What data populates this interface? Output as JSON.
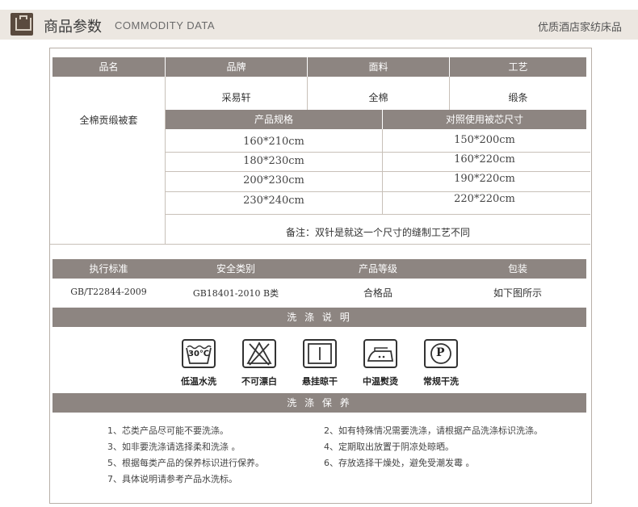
{
  "header": {
    "title_cn": "商品参数",
    "title_en": "COMMODITY DATA",
    "right_text": "优质酒店家纺床品"
  },
  "spec_table": {
    "headers": [
      "品名",
      "品牌",
      "面料",
      "工艺"
    ],
    "product_name": "全棉贡缎被套",
    "brand": "采易轩",
    "fabric": "全棉",
    "craft": "缎条",
    "size_headers": [
      "产品规格",
      "对照使用被芯尺寸"
    ],
    "sizes": [
      [
        "160*210cm",
        "150*200cm"
      ],
      [
        "180*230cm",
        "160*220cm"
      ],
      [
        "200*230cm",
        "190*220cm"
      ],
      [
        "230*240cm",
        "220*220cm"
      ]
    ],
    "remark": "备注：双针是就这一个尺寸的缝制工艺不同"
  },
  "standard_table": {
    "headers": [
      "执行标准",
      "安全类别",
      "产品等级",
      "包装"
    ],
    "values": [
      "GB/T22844-2009",
      "GB18401-2010 B类",
      "合格品",
      "如下图所示"
    ]
  },
  "wash": {
    "section_title": "洗 涤 说 明",
    "icons": [
      {
        "icon": "wash-30-icon",
        "label": "低温水洗",
        "text": "30℃"
      },
      {
        "icon": "no-bleach-icon",
        "label": "不可漂白"
      },
      {
        "icon": "hang-dry-icon",
        "label": "悬挂晾干"
      },
      {
        "icon": "iron-medium-icon",
        "label": "中温熨烫"
      },
      {
        "icon": "dry-clean-p-icon",
        "label": "常规干洗",
        "text": "P"
      }
    ]
  },
  "care": {
    "section_title": "洗 涤 保 养",
    "notes": [
      "1、芯类产品尽可能不要洗涤。",
      "2、如有特殊情况需要洗涤，请根据产品洗涤标识洗涤。",
      "3、如非要洗涤请选择柔和洗涤 。",
      "4、定期取出放置于阴凉处晾晒。",
      "5、根据每类产品的保养标识进行保养。",
      "6、存放选择干燥处，避免受潮发霉 。",
      "7、具体说明请参考产品水洗标。"
    ]
  }
}
